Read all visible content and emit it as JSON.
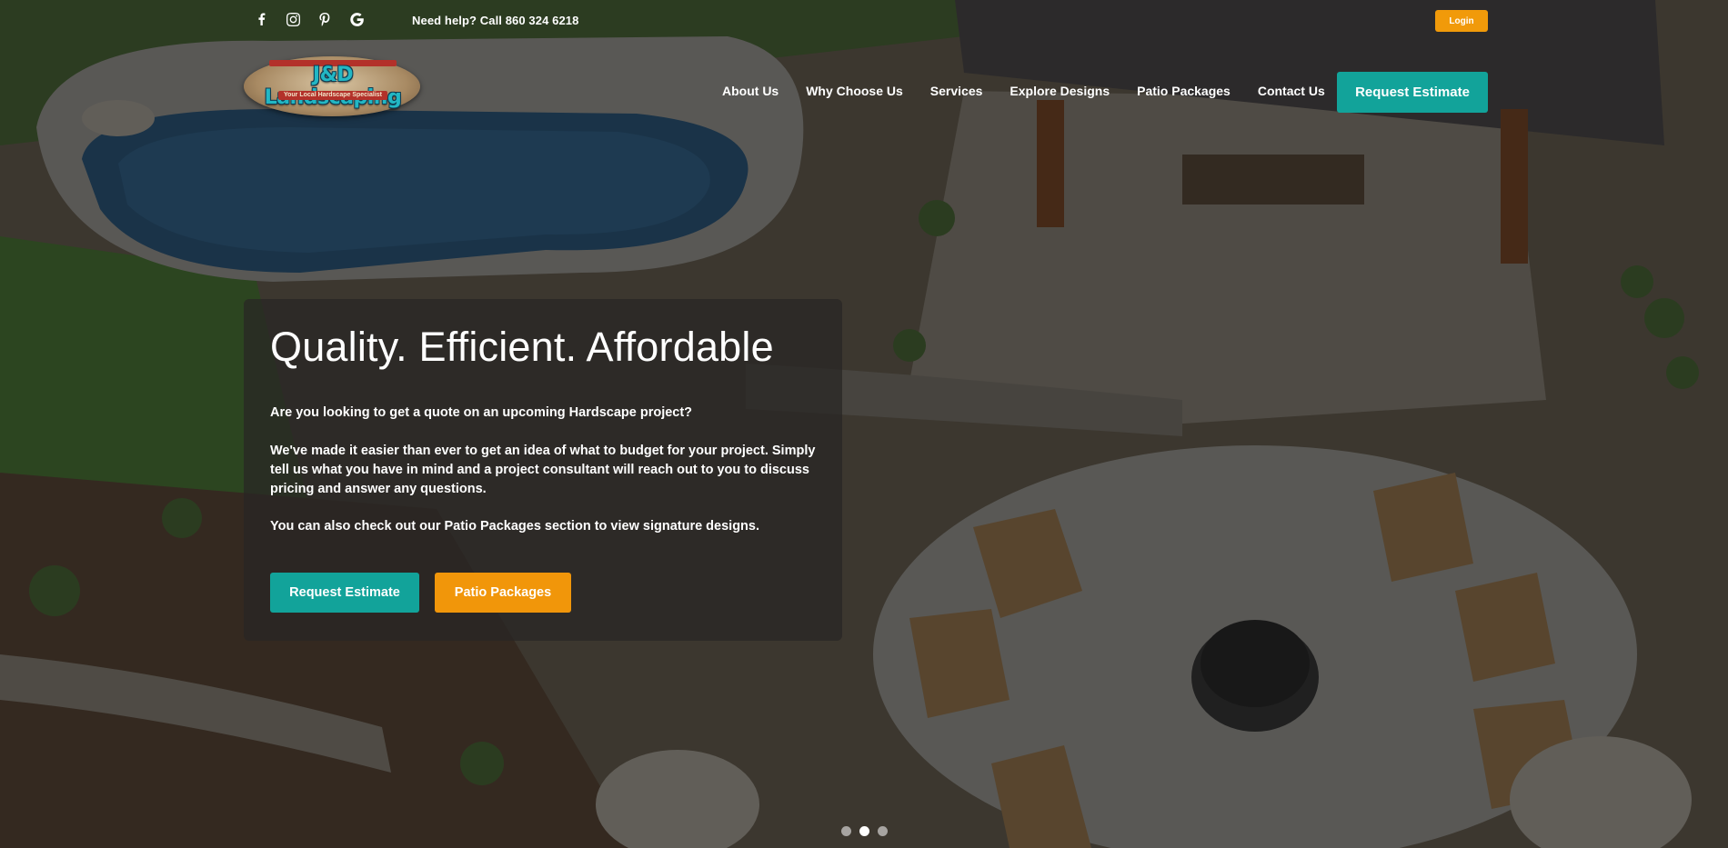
{
  "topbar": {
    "social_icons": [
      "facebook-icon",
      "instagram-icon",
      "pinterest-icon",
      "google-icon"
    ],
    "help_text": "Need help? Call 860 324 6218",
    "login_label": "Login"
  },
  "logo": {
    "name": "J&D Landscaping",
    "tagline": "Your Local Hardscape Specialist"
  },
  "nav": {
    "items": [
      "About Us",
      "Why Choose Us",
      "Services",
      "Explore Designs",
      "Patio Packages",
      "Contact Us"
    ],
    "cta_label": "Request Estimate"
  },
  "hero": {
    "title": "Quality. Efficient. Affordable",
    "paragraph_1": "Are you looking to get a quote on an upcoming Hardscape project?",
    "paragraph_2": "We've made it easier than ever to get an idea of what to budget for your project. Simply tell us what you have in mind and a project consultant will reach out to you to discuss pricing and answer any questions.",
    "paragraph_3": "You can also check out our Patio Packages section to view signature designs.",
    "button_primary": "Request Estimate",
    "button_secondary": "Patio Packages"
  },
  "slider": {
    "slide_count": 3,
    "active_slide": 2
  },
  "colors": {
    "teal": "#12a39a",
    "orange": "#f1960a",
    "login_orange": "#f19a0a"
  }
}
